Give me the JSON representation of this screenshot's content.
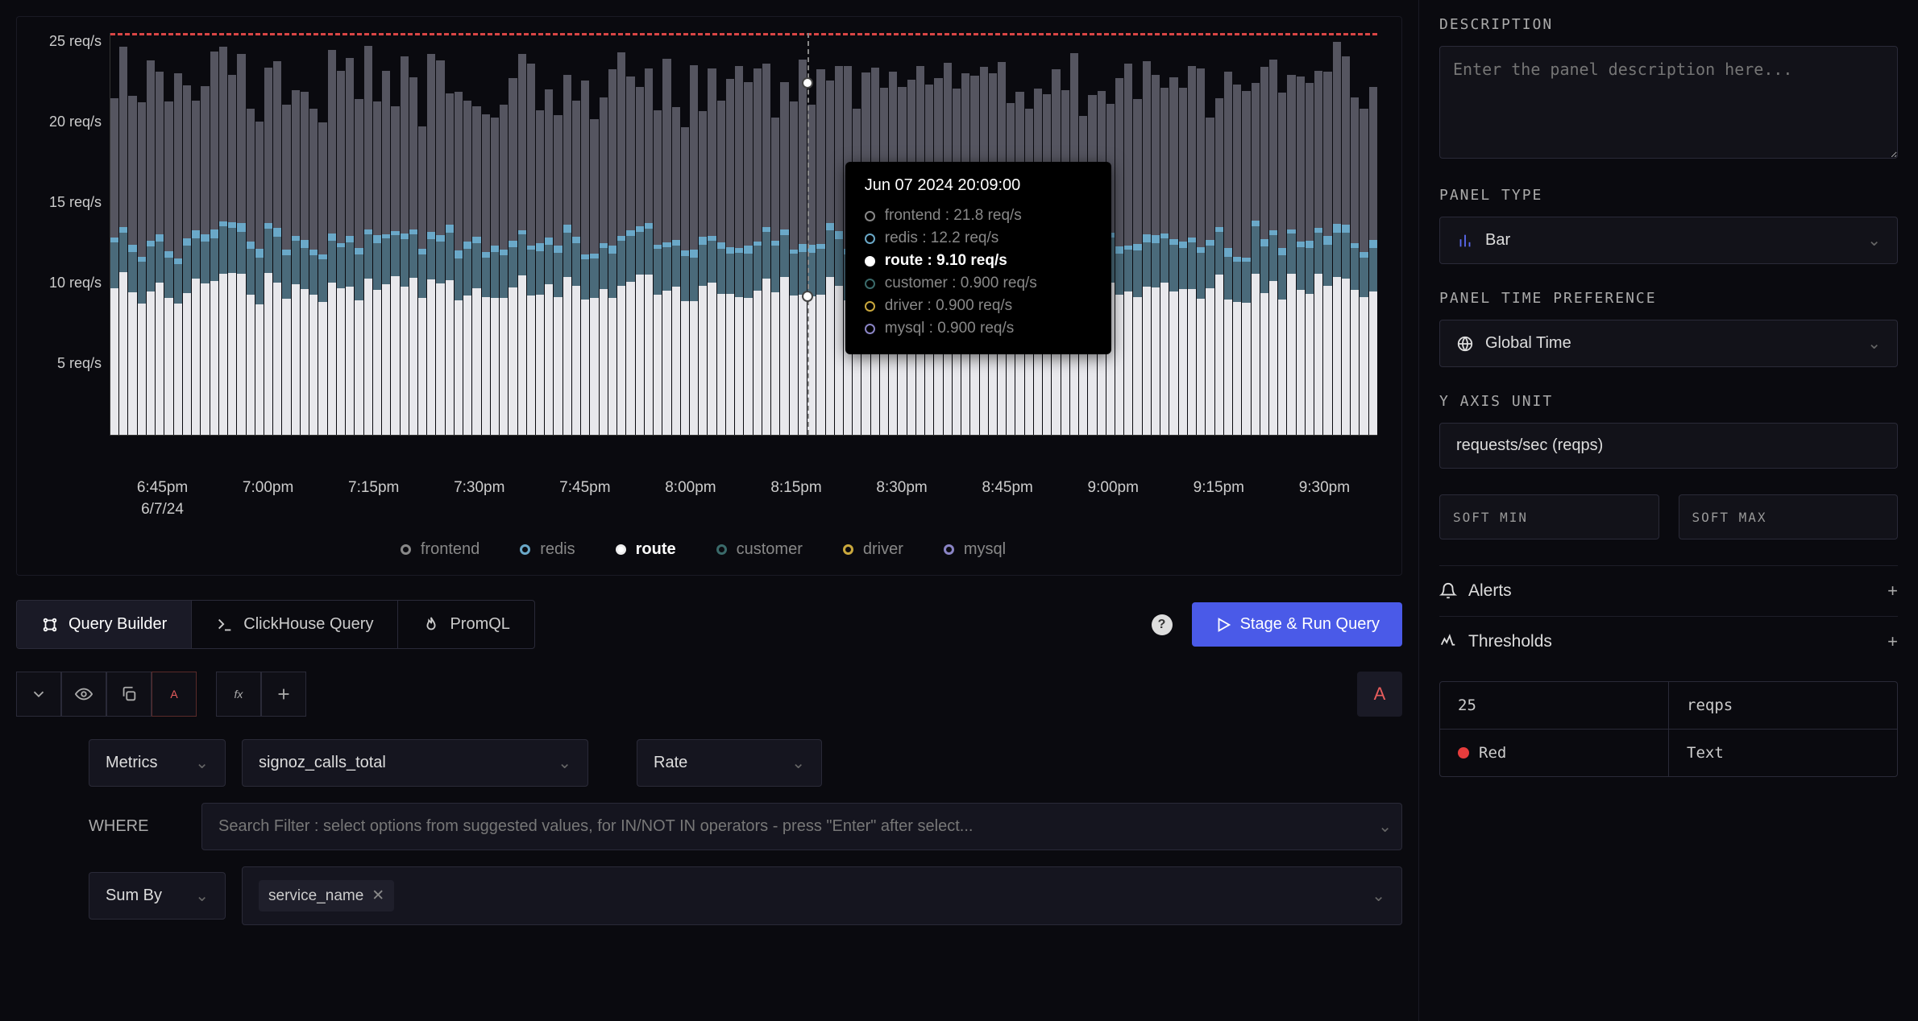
{
  "chart_data": {
    "type": "bar",
    "stacked": true,
    "ylabel": "req/s",
    "ylim": [
      0,
      25
    ],
    "y_ticks": [
      "25 req/s",
      "20 req/s",
      "15 req/s",
      "10 req/s",
      "5 req/s"
    ],
    "x_ticks": [
      {
        "time": "6:45pm",
        "date": "6/7/24"
      },
      {
        "time": "7:00pm"
      },
      {
        "time": "7:15pm"
      },
      {
        "time": "7:30pm"
      },
      {
        "time": "7:45pm"
      },
      {
        "time": "8:00pm"
      },
      {
        "time": "8:15pm"
      },
      {
        "time": "8:30pm"
      },
      {
        "time": "8:45pm"
      },
      {
        "time": "9:00pm"
      },
      {
        "time": "9:15pm"
      },
      {
        "time": "9:30pm"
      }
    ],
    "series": [
      {
        "name": "frontend",
        "color": "#888888"
      },
      {
        "name": "redis",
        "color": "#6aa8c8"
      },
      {
        "name": "route",
        "color": "#eeeeee"
      },
      {
        "name": "customer",
        "color": "#3a6a6a"
      },
      {
        "name": "driver",
        "color": "#caa83d"
      },
      {
        "name": "mysql",
        "color": "#8a84c5"
      }
    ],
    "threshold": 25,
    "tooltip": {
      "title": "Jun 07 2024 20:09:00",
      "rows": [
        {
          "name": "frontend",
          "value": "21.8 req/s",
          "color": "#888888"
        },
        {
          "name": "redis",
          "value": "12.2 req/s",
          "color": "#6aa8c8"
        },
        {
          "name": "route",
          "value": "9.10 req/s",
          "color": "#ffffff",
          "active": true
        },
        {
          "name": "customer",
          "value": "0.900 req/s",
          "color": "#3a6a6a"
        },
        {
          "name": "driver",
          "value": "0.900 req/s",
          "color": "#caa83d"
        },
        {
          "name": "mysql",
          "value": "0.900 req/s",
          "color": "#8a84c5"
        }
      ]
    },
    "legend_active": "route"
  },
  "tabs": {
    "query_builder": "Query Builder",
    "clickhouse": "ClickHouse Query",
    "promql": "PromQL"
  },
  "actions": {
    "run": "Stage & Run Query"
  },
  "query": {
    "source_label": "Metrics",
    "metric": "signoz_calls_total",
    "agg": "Rate",
    "where_label": "WHERE",
    "where_placeholder": "Search Filter : select options from suggested values, for IN/NOT IN operators - press \"Enter\" after select...",
    "sumby_label": "Sum By",
    "sumby_tag": "service_name",
    "letter": "A"
  },
  "sidebar": {
    "description_label": "DESCRIPTION",
    "description_placeholder": "Enter the panel description here...",
    "panel_type_label": "PANEL TYPE",
    "panel_type_value": "Bar",
    "time_pref_label": "PANEL TIME PREFERENCE",
    "time_pref_value": "Global Time",
    "y_unit_label": "Y AXIS UNIT",
    "y_unit_value": "requests/sec (reqps)",
    "soft_min": "SOFT MIN",
    "soft_max": "SOFT MAX",
    "alerts_label": "Alerts",
    "thresholds_label": "Thresholds",
    "threshold": {
      "value": "25",
      "unit": "reqps",
      "color": "Red",
      "format": "Text"
    }
  }
}
